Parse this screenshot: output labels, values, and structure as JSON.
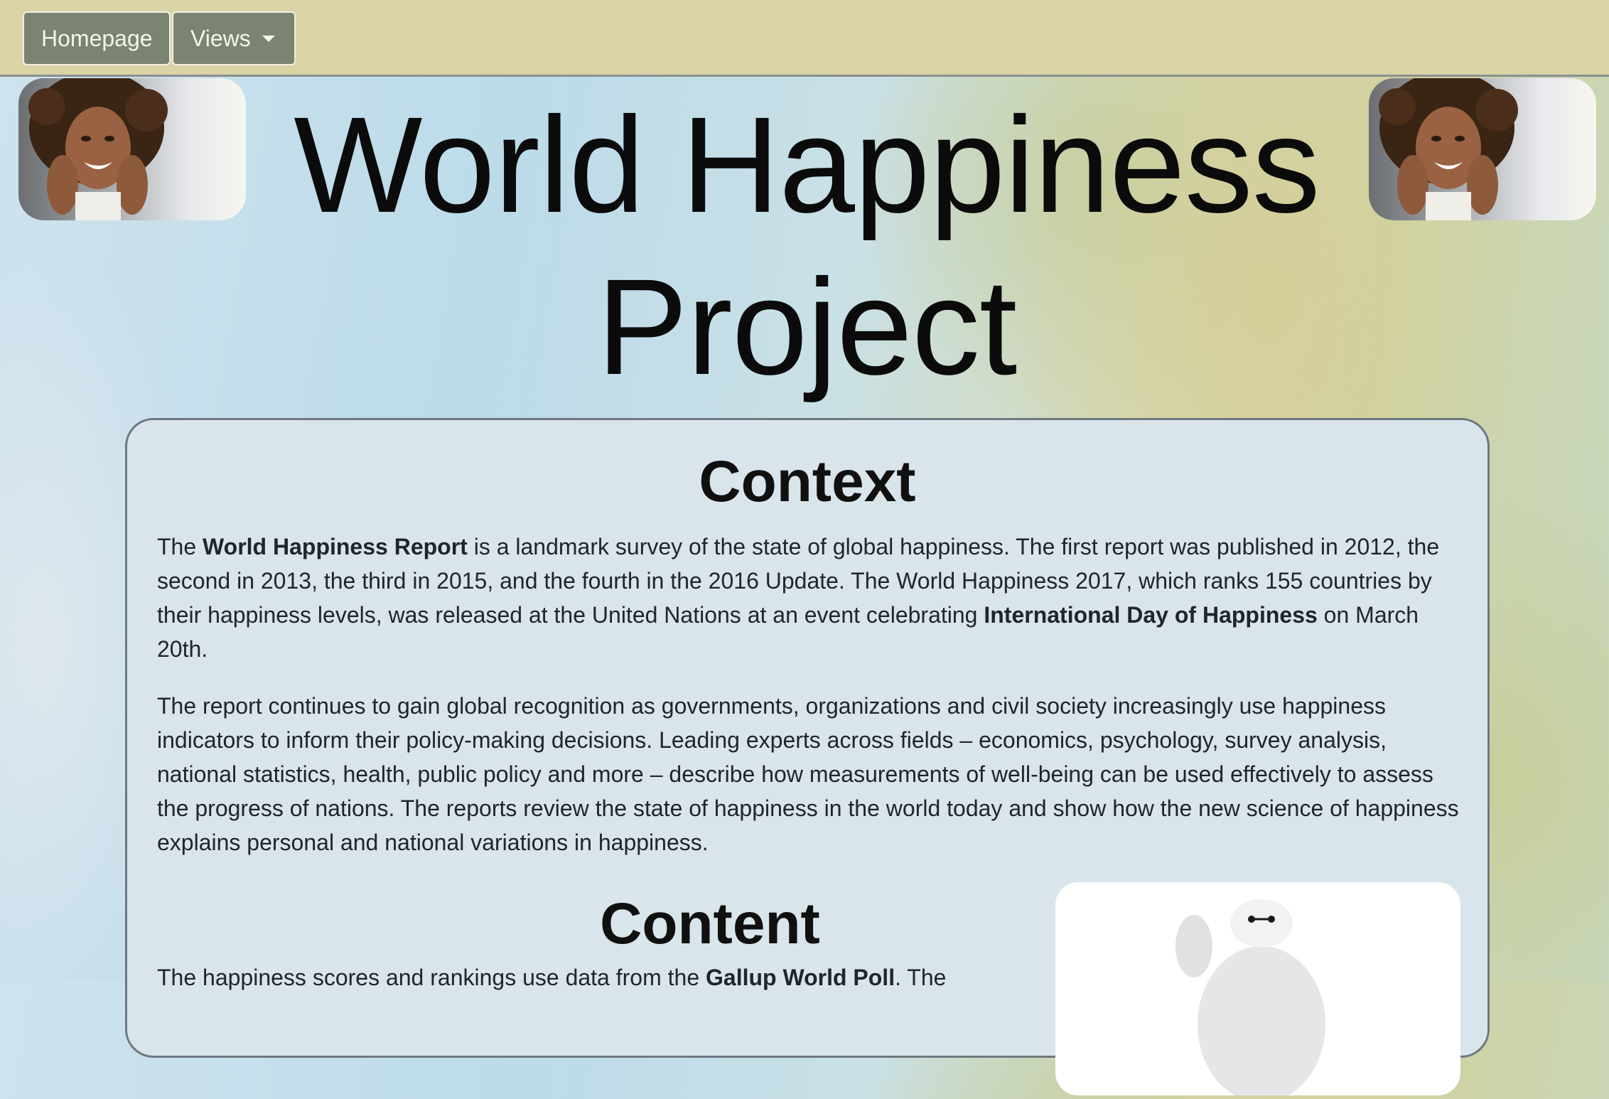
{
  "nav": {
    "home_label": "Homepage",
    "views_label": "Views"
  },
  "hero": {
    "title": "World Happiness Project"
  },
  "context": {
    "heading": "Context",
    "p1_a": "The ",
    "p1_b": "World Happiness Report",
    "p1_c": " is a landmark survey of the state of global happiness. The first report was published in 2012, the second in 2013, the third in 2015, and the fourth in the 2016 Update. The World Happiness 2017, which ranks 155 countries by their happiness levels, was released at the United Nations at an event celebrating ",
    "p1_d": "International Day of Happiness",
    "p1_e": " on March 20th.",
    "p2": "The report continues to gain global recognition as governments, organizations and civil society increasingly use happiness indicators to inform their policy-making decisions. Leading experts across fields – economics, psychology, survey analysis, national statistics, health, public policy and more – describe how measurements of well-being can be used effectively to assess the progress of nations. The reports review the state of happiness in the world today and show how the new science of happiness explains personal and national variations in happiness."
  },
  "content": {
    "heading": "Content",
    "p3_a": "The happiness scores and rankings use data from the ",
    "p3_b": "Gallup World Poll",
    "p3_c": ". The"
  },
  "colors": {
    "navbar_bg": "#d9d3a6",
    "nav_button_bg": "#7b8470",
    "card_bg": "#d9e5eb"
  }
}
